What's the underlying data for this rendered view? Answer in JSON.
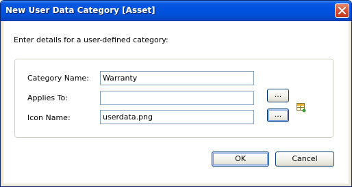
{
  "window": {
    "title": "New User Data Category [Asset]"
  },
  "dialog": {
    "instruction": "Enter details for a user-defined category:",
    "fields": {
      "category_name": {
        "label": "Category Name:",
        "value": "Warranty"
      },
      "applies_to": {
        "label": "Applies To:",
        "value": ""
      },
      "icon_name": {
        "label": "Icon Name:",
        "value": "userdata.png"
      }
    },
    "browse_label": "...",
    "icon_preview": "userdata-table-icon",
    "ok_label": "OK",
    "cancel_label": "Cancel"
  },
  "colors": {
    "titlebar": "#0053e0",
    "close_button": "#d8533a",
    "textbox_border": "#7f9db9",
    "button_border": "#003c74"
  }
}
